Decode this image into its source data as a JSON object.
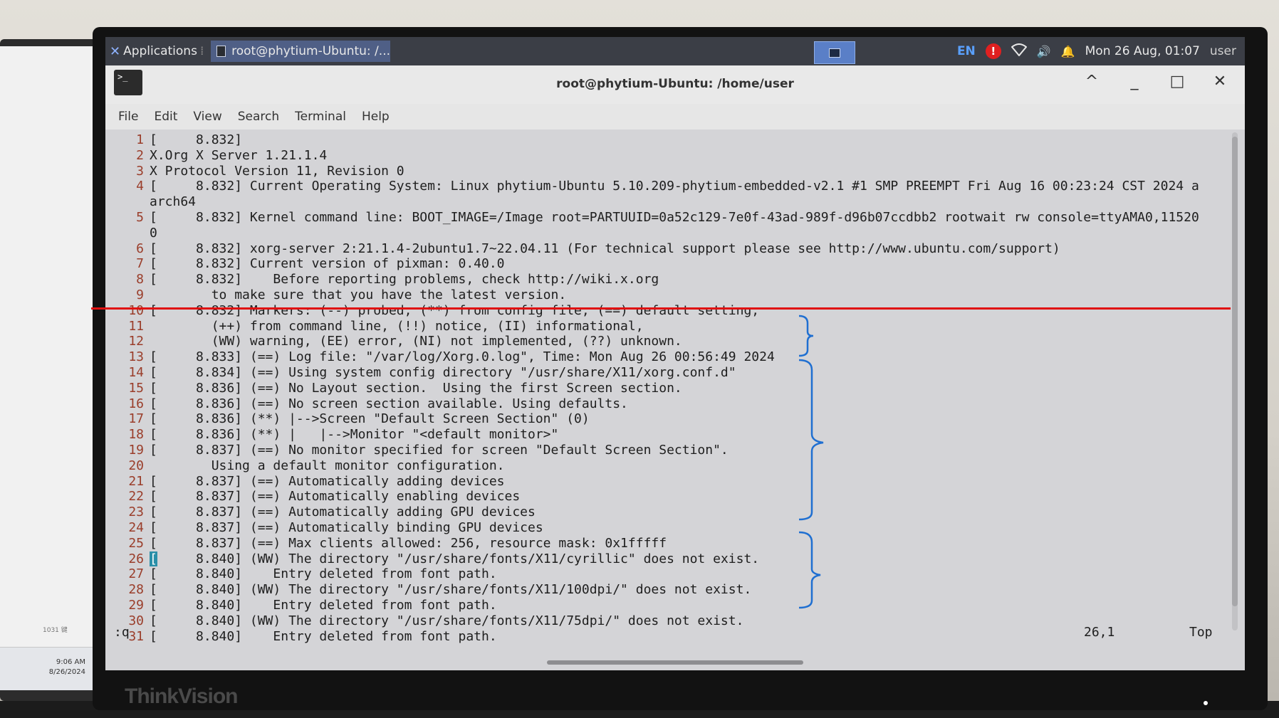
{
  "left_monitor": {
    "time": "9:06 AM",
    "date": "8/26/2024",
    "small_text": "1031 键"
  },
  "bezel_brand": "ThinkVision",
  "panel": {
    "applications_label": "Applications",
    "task_label": "root@phytium-Ubuntu: /...",
    "lang": "EN",
    "alert_symbol": "!",
    "datetime": "Mon 26 Aug, 01:07",
    "user": "user"
  },
  "window": {
    "title": "root@phytium-Ubuntu: /home/user",
    "term_icon_text": ">_",
    "controls": [
      "^",
      "_",
      "□",
      "✕"
    ]
  },
  "menu": [
    "File",
    "Edit",
    "View",
    "Search",
    "Terminal",
    "Help"
  ],
  "terminal": {
    "lines": [
      {
        "n": "1",
        "t": "[     8.832]"
      },
      {
        "n": "2",
        "t": "X.Org X Server 1.21.1.4"
      },
      {
        "n": "3",
        "t": "X Protocol Version 11, Revision 0"
      },
      {
        "n": "4",
        "t": "[     8.832] Current Operating System: Linux phytium-Ubuntu 5.10.209-phytium-embedded-v2.1 #1 SMP PREEMPT Fri Aug 16 00:23:24 CST 2024 a"
      },
      {
        "n": "",
        "t": "arch64"
      },
      {
        "n": "5",
        "t": "[     8.832] Kernel command line: BOOT_IMAGE=/Image root=PARTUUID=0a52c129-7e0f-43ad-989f-d96b07ccdbb2 rootwait rw console=ttyAMA0,11520"
      },
      {
        "n": "",
        "t": "0"
      },
      {
        "n": "6",
        "t": "[     8.832] xorg-server 2:21.1.4-2ubuntu1.7~22.04.11 (For technical support please see http://www.ubuntu.com/support)"
      },
      {
        "n": "7",
        "t": "[     8.832] Current version of pixman: 0.40.0"
      },
      {
        "n": "8",
        "t": "[     8.832]    Before reporting problems, check http://wiki.x.org"
      },
      {
        "n": "9",
        "t": "        to make sure that you have the latest version."
      },
      {
        "n": "10",
        "t": "[     8.832] Markers: (--) probed, (**) from config file, (==) default setting,"
      },
      {
        "n": "11",
        "t": "        (++) from command line, (!!) notice, (II) informational,"
      },
      {
        "n": "12",
        "t": "        (WW) warning, (EE) error, (NI) not implemented, (??) unknown."
      },
      {
        "n": "13",
        "t": "[     8.833] (==) Log file: \"/var/log/Xorg.0.log\", Time: Mon Aug 26 00:56:49 2024"
      },
      {
        "n": "14",
        "t": "[     8.834] (==) Using system config directory \"/usr/share/X11/xorg.conf.d\""
      },
      {
        "n": "15",
        "t": "[     8.836] (==) No Layout section.  Using the first Screen section."
      },
      {
        "n": "16",
        "t": "[     8.836] (==) No screen section available. Using defaults."
      },
      {
        "n": "17",
        "t": "[     8.836] (**) |-->Screen \"Default Screen Section\" (0)"
      },
      {
        "n": "18",
        "t": "[     8.836] (**) |   |-->Monitor \"<default monitor>\""
      },
      {
        "n": "19",
        "t": "[     8.837] (==) No monitor specified for screen \"Default Screen Section\"."
      },
      {
        "n": "20",
        "t": "        Using a default monitor configuration."
      },
      {
        "n": "21",
        "t": "[     8.837] (==) Automatically adding devices"
      },
      {
        "n": "22",
        "t": "[     8.837] (==) Automatically enabling devices"
      },
      {
        "n": "23",
        "t": "[     8.837] (==) Automatically adding GPU devices"
      },
      {
        "n": "24",
        "t": "[     8.837] (==) Automatically binding GPU devices"
      },
      {
        "n": "25",
        "t": "[     8.837] (==) Max clients allowed: 256, resource mask: 0x1fffff"
      },
      {
        "n": "26",
        "t": "[     8.840] (WW) The directory \"/usr/share/fonts/X11/cyrillic\" does not exist."
      },
      {
        "n": "27",
        "t": "[     8.840]    Entry deleted from font path."
      },
      {
        "n": "28",
        "t": "[     8.840] (WW) The directory \"/usr/share/fonts/X11/100dpi/\" does not exist."
      },
      {
        "n": "29",
        "t": "[     8.840]    Entry deleted from font path."
      },
      {
        "n": "30",
        "t": "[     8.840] (WW) The directory \"/usr/share/fonts/X11/75dpi/\" does not exist."
      },
      {
        "n": "31",
        "t": "[     8.840]    Entry deleted from font path."
      }
    ],
    "command": ":q",
    "cursor_pos": "26,1",
    "scroll_where": "Top"
  },
  "colors": {
    "panel_bg": "#3b3e46",
    "task_active": "#4f5f86",
    "terminal_bg": "#d4d4d7",
    "line_number": "#9a3d2a",
    "annotation_red": "#e01010",
    "annotation_blue": "#1f6fd1"
  }
}
